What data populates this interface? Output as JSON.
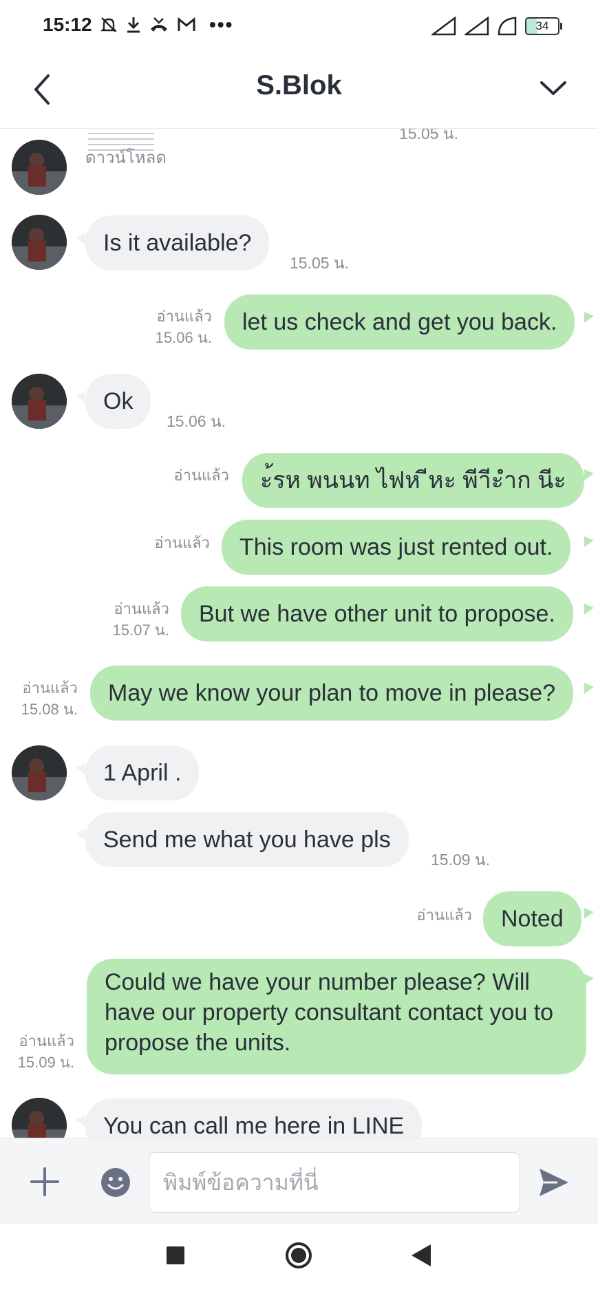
{
  "status": {
    "time": "15:12",
    "battery": "34",
    "icons": [
      "bell-off-icon",
      "download-icon",
      "missed-call-icon",
      "gmail-icon",
      "more-icon",
      "signal-icon",
      "signal-icon",
      "signal-icon",
      "battery-icon"
    ]
  },
  "header": {
    "title": "S.Blok",
    "back_icon": "chevron-left-icon",
    "menu_icon": "chevron-down-icon"
  },
  "chat": {
    "file_message": {
      "download_label": "ดาวน์โหลด",
      "time": "15.05 น."
    },
    "messages": [
      {
        "dir": "in",
        "text": "Is it available?",
        "time": "15.05 น.",
        "read": ""
      },
      {
        "dir": "out",
        "text": "let us check and get you back.",
        "read": "อ่านแล้ว",
        "time": "15.06 น."
      },
      {
        "dir": "in",
        "text": "Ok",
        "time": "15.06 น.",
        "read": ""
      },
      {
        "dir": "out",
        "text": "ะ้รห พนนท ไฟห ีหะ พีาีะำก นีะ",
        "read": "อ่านแล้ว",
        "time": ""
      },
      {
        "dir": "out",
        "text": "This room was just rented out.",
        "read": "อ่านแล้ว",
        "time": ""
      },
      {
        "dir": "out",
        "text": "But we have other unit to propose.",
        "read": "อ่านแล้ว",
        "time": "15.07 น."
      },
      {
        "dir": "out",
        "text": "May we know your plan to move in please?",
        "read": "อ่านแล้ว",
        "time": "15.08 น."
      },
      {
        "dir": "in",
        "text": "1 April .",
        "time": "",
        "read": ""
      },
      {
        "dir": "in",
        "text": "Send me what you have pls",
        "time": "15.09 น.",
        "read": ""
      },
      {
        "dir": "out",
        "text": "Noted",
        "read": "อ่านแล้ว",
        "time": ""
      },
      {
        "dir": "out",
        "text": "Could we have your number please? Will have our property consultant contact you to propose the units.",
        "read": "อ่านแล้ว",
        "time": "15.09 น."
      },
      {
        "dir": "in",
        "text": "You can call me here in LINE",
        "time": "",
        "read": ""
      }
    ]
  },
  "input": {
    "placeholder": "พิมพ์ข้อความที่นี่",
    "value": ""
  },
  "colors": {
    "outgoing_bubble": "#b8e8b4",
    "incoming_bubble": "#f0f1f3",
    "meta_text": "#8a8e96",
    "icon": "#6a7185"
  }
}
